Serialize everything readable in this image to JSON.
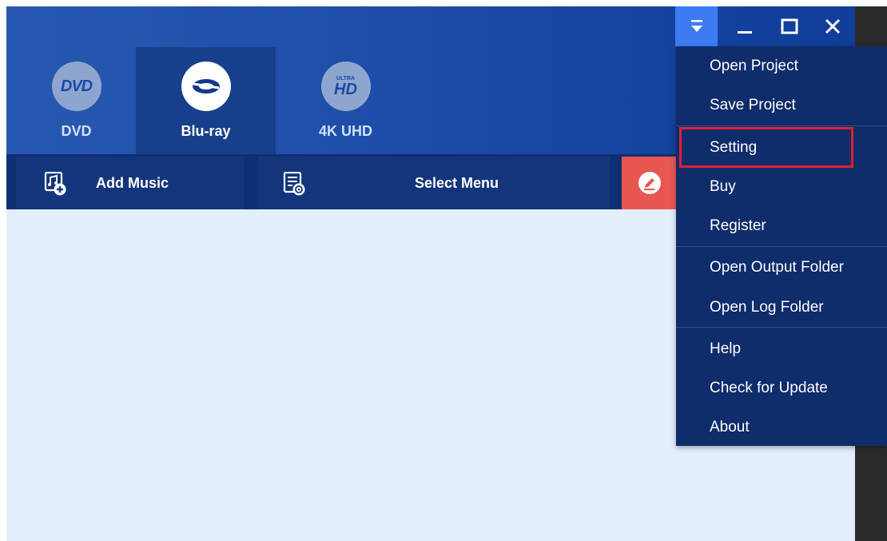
{
  "tabs": [
    {
      "label": "DVD",
      "logo_text": "DVD"
    },
    {
      "label": "Blu-ray",
      "logo_text": ""
    },
    {
      "label": "4K UHD",
      "logo_text": "HD",
      "logo_sub": "ULTRA"
    }
  ],
  "toolbar": {
    "add_music": "Add Music",
    "select_menu": "Select Menu"
  },
  "menu": {
    "items": [
      "Open Project",
      "Save Project",
      "Setting",
      "Buy",
      "Register",
      "Open Output Folder",
      "Open Log Folder",
      "Help",
      "Check for Update",
      "About"
    ]
  },
  "colors": {
    "header": "#1a4aa6",
    "menu_bg": "#0f2c6b",
    "highlight": "#e02030",
    "edit_button": "#e85650",
    "content_bg": "#e3eefc"
  }
}
